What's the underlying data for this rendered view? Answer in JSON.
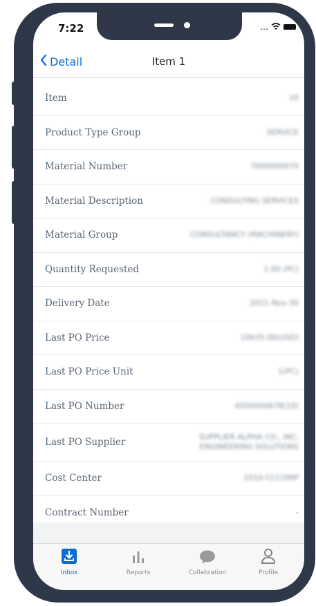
{
  "status": {
    "time": "7:22"
  },
  "nav": {
    "back_label": "Detail",
    "title": "Item 1"
  },
  "rows": [
    {
      "label": "Item",
      "value": "10"
    },
    {
      "label": "Product Type Group",
      "value": "SERVICE"
    },
    {
      "label": "Material Number",
      "value": "7000000070"
    },
    {
      "label": "Material Description",
      "value": "CONSULTING SERVICES"
    },
    {
      "label": "Material Group",
      "value": "CONSULTANCY (MACHINERY)"
    },
    {
      "label": "Quantity Requested",
      "value": "1.00 (PC)"
    },
    {
      "label": "Delivery Date",
      "value": "2021-Nov-30"
    },
    {
      "label": "Last PO Price",
      "value": "10635.00(USD)"
    },
    {
      "label": "Last PO Price Unit",
      "value": "1(PC)"
    },
    {
      "label": "Last PO Number",
      "value": "4500000678(10)"
    },
    {
      "label": "Last PO Supplier",
      "value": "SUPPLIER ALPHA CO., INC. ENGINEERING SOLUTIONS"
    },
    {
      "label": "Cost Center",
      "value": "1010-CCCOMP"
    },
    {
      "label": "Contract Number",
      "value": "-"
    }
  ],
  "tabs": [
    {
      "label": "Inbox",
      "icon": "inbox-icon",
      "active": true
    },
    {
      "label": "Reports",
      "icon": "bar-chart-icon",
      "active": false
    },
    {
      "label": "Collabration",
      "icon": "chat-bubble-icon",
      "active": false
    },
    {
      "label": "Profile",
      "icon": "person-icon",
      "active": false
    }
  ],
  "colors": {
    "accent": "#0a6ed1",
    "frame": "#2f3848"
  }
}
